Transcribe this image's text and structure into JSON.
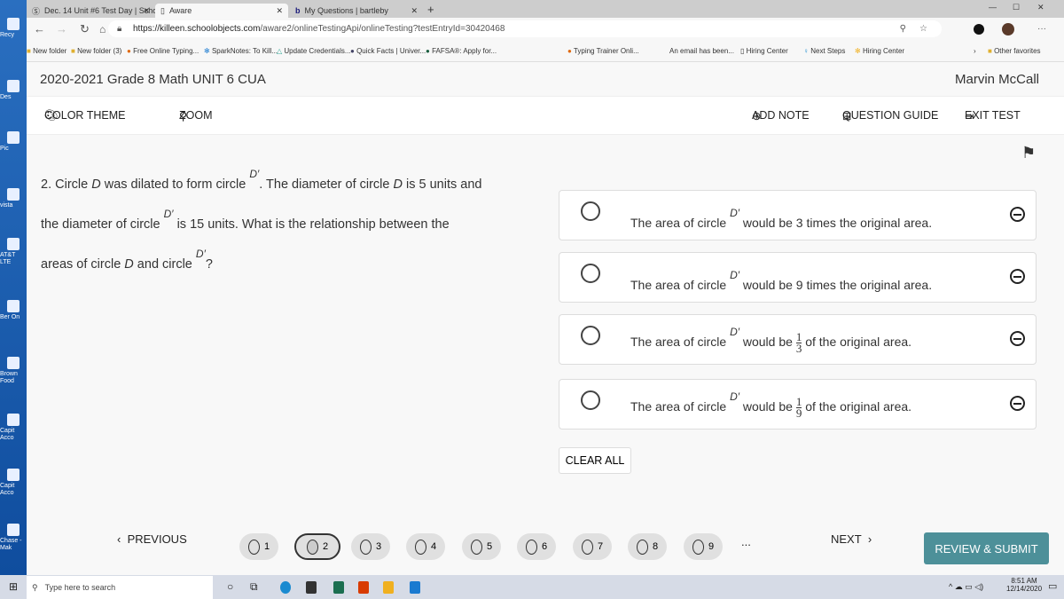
{
  "desktop": {
    "icons": [
      "Recy",
      "Des",
      "Pic",
      "vista",
      "AT&T LTE",
      "Ber On",
      "Brown Food",
      "Capit Acco",
      "Capit Acco",
      "Chase - Mak"
    ]
  },
  "browser": {
    "tabs": [
      {
        "label": "Dec. 14 Unit #6 Test Day | Schoo"
      },
      {
        "label": "Aware"
      },
      {
        "label": "My Questions | bartleby"
      }
    ],
    "url_host": "https://killeen.schoolobjects.com",
    "url_path": "/aware2/onlineTestingApi/onlineTesting?testEntryId=30420468",
    "bookmarks": [
      "New folder",
      "New folder (3)",
      "Free Online Typing...",
      "SparkNotes: To Kill...",
      "Update Credentials...",
      "Quick Facts | Univer...",
      "FAFSA®: Apply for...",
      "Typing Trainer Onli...",
      "An email has been...",
      "Hiring Center",
      "Next Steps",
      "Hiring Center"
    ],
    "other_favorites": "Other favorites"
  },
  "header": {
    "title": "2020-2021 Grade 8 Math UNIT 6 CUA",
    "user": "Marvin McCall"
  },
  "toolbar": {
    "color_theme": "COLOR THEME",
    "zoom": "ZOOM",
    "add_note": "ADD NOTE",
    "question_guide": "QUESTION GUIDE",
    "exit_test": "EXIT TEST"
  },
  "question": {
    "p1": "2. Circle ",
    "D": "D",
    "p2": " was dilated to form circle ",
    "Dp": "D′",
    "p3": ". The diameter of circle ",
    "p4": " is 5 units and",
    "p5": "the diameter of circle ",
    "p6": " is 15 units. What is the relationship between the",
    "p7": "areas of circle ",
    "p8": " and circle ",
    "p9": "?"
  },
  "options": [
    {
      "pre": "The area of circle ",
      "sym": "D′",
      "post": " would be 3 times the original area."
    },
    {
      "pre": "The area of circle ",
      "sym": "D′",
      "post": " would be 9 times the original area."
    },
    {
      "pre": "The area of circle ",
      "sym": "D′",
      "post": " would be ",
      "num": "1",
      "den": "3",
      "end": " of the original area."
    },
    {
      "pre": "The area of circle ",
      "sym": "D′",
      "post": " would be ",
      "num": "1",
      "den": "9",
      "end": " of the original area."
    }
  ],
  "clear_all": "CLEAR ALL",
  "nav": {
    "previous": "PREVIOUS",
    "next": "NEXT",
    "ellipsis": "...",
    "review": "REVIEW & SUBMIT",
    "pages": [
      "1",
      "2",
      "3",
      "4",
      "5",
      "6",
      "7",
      "8",
      "9"
    ],
    "current": "2"
  },
  "taskbar": {
    "search_placeholder": "Type here to search",
    "time": "8:51 AM",
    "date": "12/14/2020"
  }
}
